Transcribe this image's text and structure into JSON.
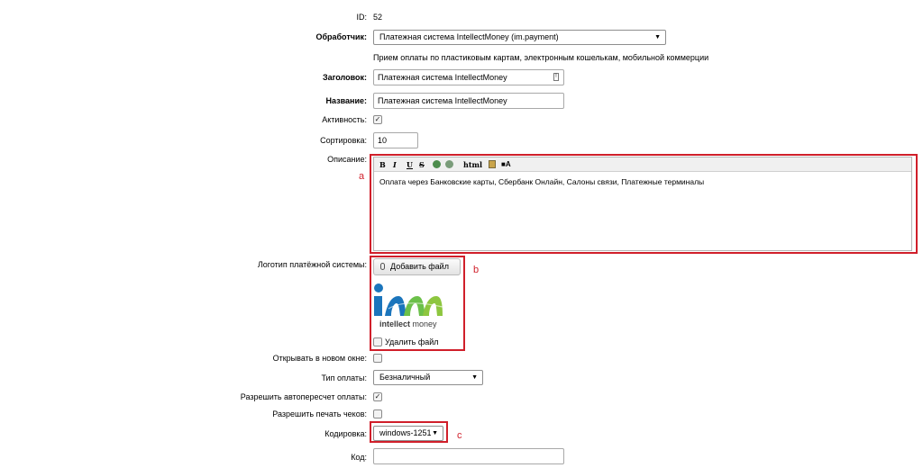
{
  "id_row": {
    "label": "ID:",
    "value": "52"
  },
  "handler": {
    "label": "Обработчик:",
    "value": "Платежная система IntellectMoney (im.payment)",
    "description": "Прием оплаты по пластиковым картам, электронным кошелькам, мобильной коммерции"
  },
  "heading": {
    "label": "Заголовок:",
    "value": "Платежная система IntellectMoney"
  },
  "name": {
    "label": "Название:",
    "value": "Платежная система IntellectMoney"
  },
  "active": {
    "label": "Активность:",
    "checked": true
  },
  "sort": {
    "label": "Сортировка:",
    "value": "10"
  },
  "description": {
    "label": "Описание:",
    "toolbar": {
      "bold": "B",
      "italic": "I",
      "underline": "U",
      "strike": "S",
      "html": "html"
    },
    "content": "Оплата через Банковские карты, Сбербанк Онлайн, Салоны связи, Платежные терминалы"
  },
  "logo": {
    "label": "Логотип платёжной системы:",
    "add_button": "Добавить файл",
    "brand_text_bold": "intellect",
    "brand_text_light": "money",
    "delete_label": "Удалить файл"
  },
  "new_window": {
    "label": "Открывать в новом окне:",
    "checked": false
  },
  "payment_type": {
    "label": "Тип оплаты:",
    "value": "Безналичный"
  },
  "auto_recalc": {
    "label": "Разрешить автопересчет оплаты:",
    "checked": true
  },
  "print_checks": {
    "label": "Разрешить печать чеков:",
    "checked": false
  },
  "encoding": {
    "label": "Кодировка:",
    "value": "windows-1251"
  },
  "code": {
    "label": "Код:",
    "value": ""
  },
  "annotations": {
    "a": "a",
    "b": "b",
    "c": "c"
  },
  "colors": {
    "annotation": "#d01f2a",
    "logo_blue": "#1b75bc",
    "logo_green": "#6cc04a"
  }
}
